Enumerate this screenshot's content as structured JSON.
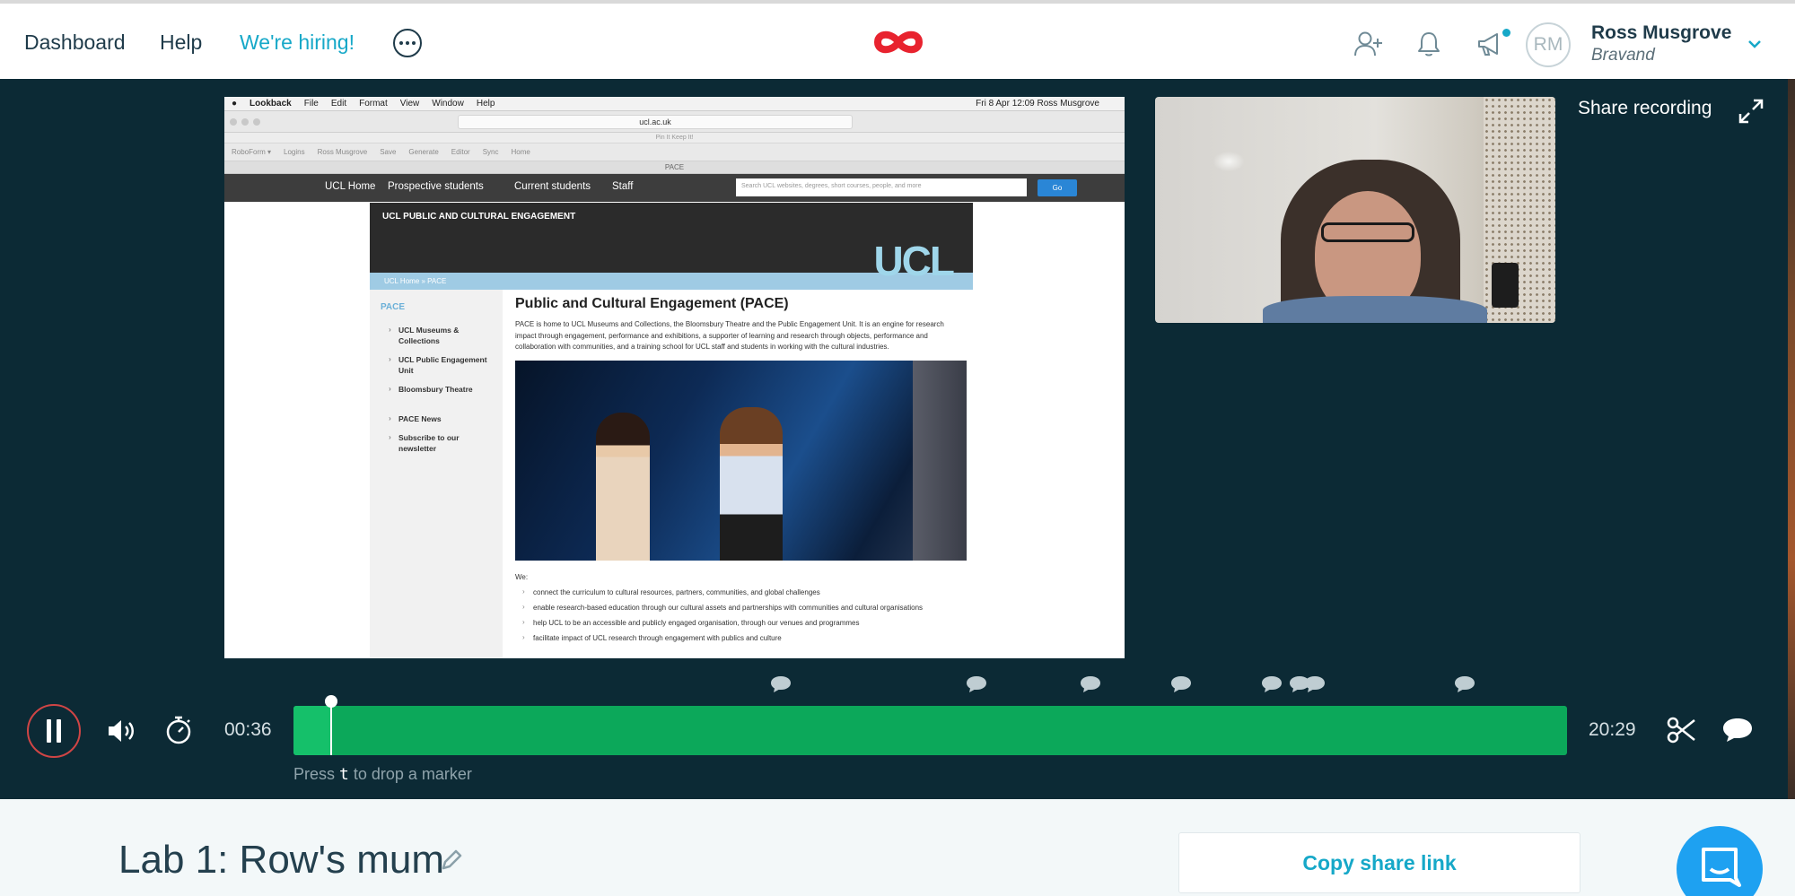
{
  "nav": {
    "dashboard": "Dashboard",
    "help": "Help",
    "hiring": "We're hiring!"
  },
  "user": {
    "initials": "RM",
    "name": "Ross Musgrove",
    "org": "Bravand"
  },
  "recording": {
    "browser_menubar": {
      "app": "Lookback",
      "menus": [
        "File",
        "Edit",
        "Format",
        "View",
        "Window",
        "Help"
      ],
      "status": "Fri 8 Apr 12:09   Ross Musgrove"
    },
    "url": "ucl.ac.uk",
    "fav_strip": "Pin It    Keep It!",
    "bookmarks": [
      "RoboForm ▾",
      "Logins",
      "Ross Musgrove",
      "Save",
      "Generate",
      "Editor",
      "Sync",
      "Home"
    ],
    "tab_title": "PACE",
    "site_nav": [
      "UCL Home",
      "Prospective students",
      "Current students",
      "Staff"
    ],
    "search_placeholder": "Search UCL websites, degrees, short courses, people, and more",
    "go": "Go",
    "dept": "UCL PUBLIC AND CULTURAL ENGAGEMENT",
    "logo_text": "UCL",
    "breadcrumb": "UCL Home  »  PACE",
    "sidebar_title": "PACE",
    "sidebar_items": [
      "UCL Museums & Collections",
      "UCL Public Engagement Unit",
      "Bloomsbury Theatre"
    ],
    "sidebar_items_2": [
      "PACE News",
      "Subscribe to our newsletter"
    ],
    "heading": "Public and Cultural Engagement (PACE)",
    "intro": "PACE is home to UCL Museums and Collections, the Bloomsbury Theatre and the Public Engagement Unit. It is an engine for research impact through engagement, performance and exhibitions, a supporter of learning and research through objects, performance and collaboration with communities, and a training school for UCL staff and students in working with the cultural industries.",
    "we": "We:",
    "bullets": [
      "connect the curriculum to cultural resources, partners, communities, and global challenges",
      "enable research-based education through our cultural assets and partnerships with communities and cultural organisations",
      "help UCL to be an accessible and publicly engaged organisation, through our venues and programmes",
      "facilitate impact of UCL research through engagement with publics and culture"
    ]
  },
  "share_recording": "Share recording",
  "player": {
    "current_time": "00:36",
    "total_time": "20:29",
    "progress_fraction": 0.029,
    "comment_marker_fractions": [
      0.383,
      0.536,
      0.626,
      0.697,
      0.768,
      0.79,
      0.802,
      0.92
    ],
    "hint_before": "Press ",
    "hint_key": "t",
    "hint_after": " to drop a marker"
  },
  "title": "Lab 1: Row's mum",
  "copy_share_link": "Copy share link",
  "colors": {
    "accent": "#16a8c8",
    "player_bg": "#0c2a35",
    "track": "#0ca85a",
    "pause_ring": "#d04545",
    "logo": "#e8232f"
  },
  "icons": [
    "more-icon",
    "infinity-logo",
    "add-user-icon",
    "bell-icon",
    "megaphone-icon",
    "chevron-down-icon",
    "expand-icon",
    "pause-icon",
    "volume-icon",
    "timer-icon",
    "scissors-icon",
    "comment-icon",
    "pencil-icon",
    "chat-icon"
  ]
}
